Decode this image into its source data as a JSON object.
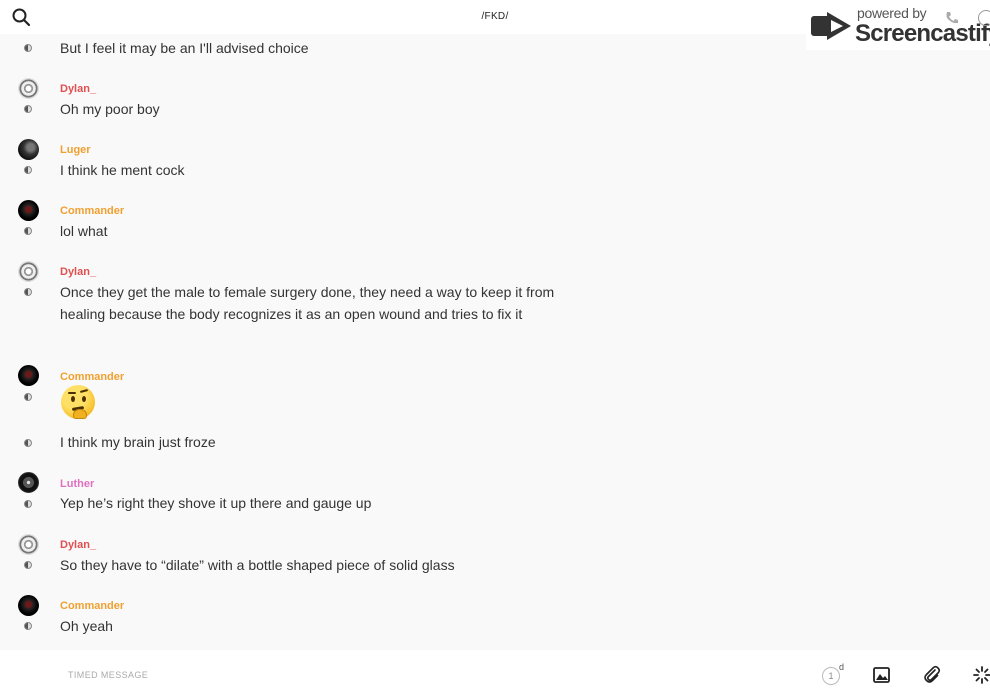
{
  "header": {
    "title": "/FKD/",
    "search_icon": "search-icon"
  },
  "watermark": {
    "small": "powered by",
    "big": "Screencastify"
  },
  "messages": [
    {
      "sender": "",
      "avatar": "",
      "text": "But I feel it may be an I'll advised choice"
    },
    {
      "sender": "Dylan_",
      "sender_color": "#e05050",
      "avatar": "dylan",
      "text": "Oh my poor boy"
    },
    {
      "sender": "Luger",
      "sender_color": "#f0a030",
      "avatar": "luger",
      "text": "I think he ment cock"
    },
    {
      "sender": "Commander",
      "sender_color": "#f0a030",
      "avatar": "commander",
      "text": "lol what"
    },
    {
      "sender": "Dylan_",
      "sender_color": "#e05050",
      "avatar": "dylan",
      "text": "Once they get the male to female surgery done, they need a way to keep it from healing because the body recognizes it as an open wound and tries to fix it"
    },
    {
      "sender": "Commander",
      "sender_color": "#f0a030",
      "avatar": "commander",
      "emoji": "thinking-face"
    },
    {
      "sender": "",
      "avatar": "",
      "text": "I think my brain just froze"
    },
    {
      "sender": "Luther",
      "sender_color": "#e070c0",
      "avatar": "luther",
      "text": "Yep he’s right they shove it up there and gauge up"
    },
    {
      "sender": "Dylan_",
      "sender_color": "#e05050",
      "avatar": "dylan",
      "text": "So they have to “dilate” with a bottle shaped piece of solid glass"
    },
    {
      "sender": "Commander",
      "sender_color": "#f0a030",
      "avatar": "commander",
      "text": "Oh yeah"
    }
  ],
  "composer": {
    "placeholder": "TIMED MESSAGE",
    "timer_value": "1",
    "timer_unit": "d",
    "icons": [
      "image-icon",
      "paperclip-icon",
      "sparkle-icon"
    ]
  }
}
